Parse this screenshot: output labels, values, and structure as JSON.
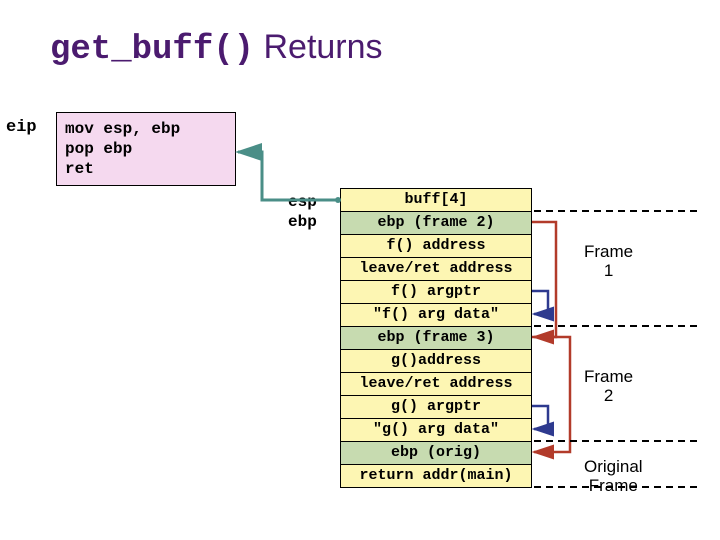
{
  "title": {
    "code": "get_buff()",
    "rest": " Returns"
  },
  "eip_label": "eip",
  "code_lines": "mov esp, ebp\npop ebp\nret",
  "ptr_labels": {
    "esp": "esp",
    "ebp": "ebp"
  },
  "stack": [
    {
      "text": "buff[4]",
      "class": "yellow"
    },
    {
      "text": "ebp (frame 2)",
      "class": "green"
    },
    {
      "text": "f() address",
      "class": "yellow"
    },
    {
      "text": "leave/ret address",
      "class": "yellow"
    },
    {
      "text": "f() argptr",
      "class": "yellow"
    },
    {
      "text": "\"f() arg data\"",
      "class": "yellow"
    },
    {
      "text": "ebp (frame 3)",
      "class": "green"
    },
    {
      "text": "g()address",
      "class": "yellow"
    },
    {
      "text": "leave/ret address",
      "class": "yellow"
    },
    {
      "text": "g() argptr",
      "class": "yellow"
    },
    {
      "text": "\"g() arg data\"",
      "class": "yellow"
    },
    {
      "text": "ebp (orig)",
      "class": "green"
    },
    {
      "text": "return addr(main)",
      "class": "yellow"
    }
  ],
  "frames": {
    "f1": "Frame\n1",
    "f2": "Frame\n2",
    "orig": "Original\nFrame"
  },
  "colors": {
    "arrow_teal": "#4a8e87",
    "arrow_red": "#b23b2a",
    "arrow_blue": "#2e3a8f"
  }
}
